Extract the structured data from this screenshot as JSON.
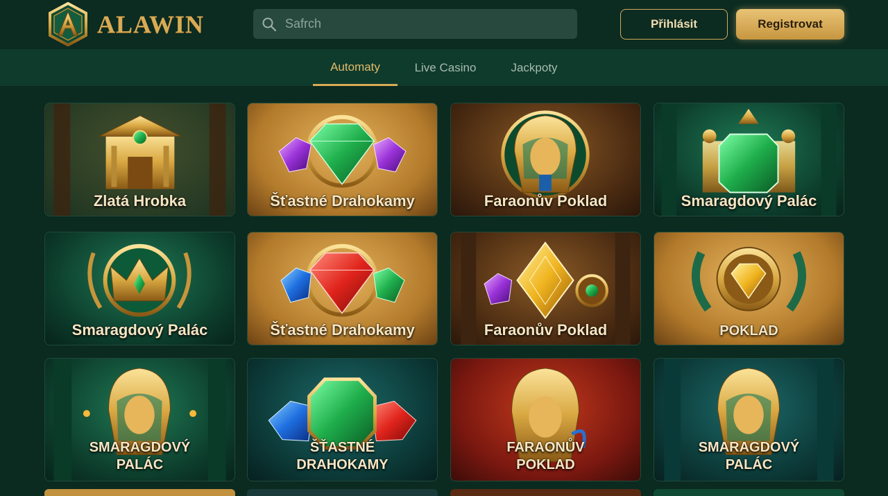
{
  "header": {
    "logo_text": "ALAWIN",
    "logo_icon": "alawin-emblem-icon",
    "search_placeholder": "Safrch",
    "search_icon": "search-icon",
    "login_label": "Přihlásit",
    "register_label": "Registrovat"
  },
  "tabs": [
    "Automaty",
    "Live Casino",
    "Jackpoty"
  ],
  "active_tab": "Automaty",
  "colors": {
    "accent_gold": "#d9ab55",
    "background": "#0b2a20",
    "tabbar": "#0f3b2c"
  },
  "games": [
    {
      "title": "Zlatá Hrobka",
      "art": "golden-temple-icon"
    },
    {
      "title": "Šťastné Drahokamy",
      "art": "emerald-gems-icon"
    },
    {
      "title": "Faraonův Poklad",
      "art": "pharaoh-mask-icon"
    },
    {
      "title": "Smaragdový Palác",
      "art": "emerald-palace-icon"
    },
    {
      "title": "Smaragdový Palác",
      "art": "golden-crown-icon"
    },
    {
      "title": "Šťastné Drahokamy",
      "art": "ruby-gems-icon"
    },
    {
      "title": "Faraonův Poklad",
      "art": "golden-gem-icon"
    },
    {
      "title": "POKLAD",
      "art": "gold-diamond-emblem-icon"
    },
    {
      "title_line1": "SMARAGDOVÝ",
      "title_line2": "PALÁC",
      "art": "pharaoh-mask-icon"
    },
    {
      "title_line1": "ŠŤASTNÉ",
      "title_line2": "DRAHOKAMY",
      "art": "emerald-gems-icon"
    },
    {
      "title_line1": "FARAONŮV",
      "title_line2": "POKLAD",
      "art": "pharaoh-mask-icon"
    },
    {
      "title_line1": "SMARAGDOVÝ",
      "title_line2": "PALÁC",
      "art": "pharaoh-mask-icon"
    }
  ]
}
